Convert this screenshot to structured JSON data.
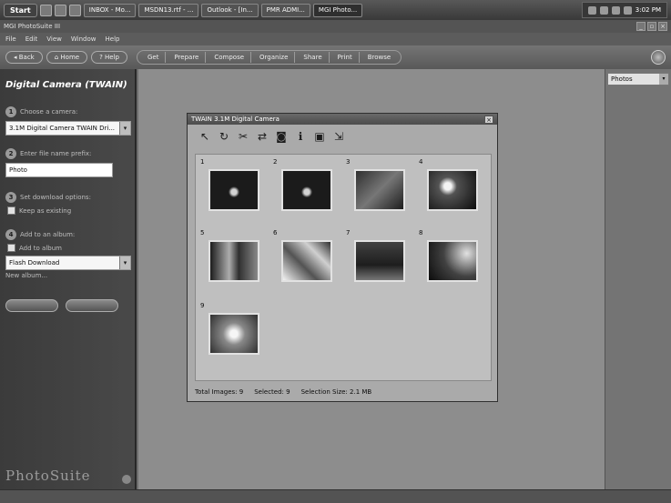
{
  "taskbar": {
    "start_label": "Start",
    "tasks": [
      "INBOX - Mo...",
      "MSDN13.rtf - ...",
      "Outlook - [In...",
      "PMR ADMI...",
      "MGI Photo..."
    ],
    "clock": "3:02 PM"
  },
  "window": {
    "title": "MGI PhotoSuite III",
    "minimize": "_",
    "maximize": "▫",
    "close": "×"
  },
  "menu": [
    "File",
    "Edit",
    "View",
    "Window",
    "Help"
  ],
  "modebar": {
    "back": "◂ Back",
    "home": "⌂ Home",
    "help": "? Help",
    "tabs": [
      "Get",
      "Prepare",
      "Compose",
      "Organize",
      "Share",
      "Print",
      "Browse"
    ]
  },
  "sidebar": {
    "title": "Digital Camera (TWAIN)",
    "step1_label": "Choose a camera:",
    "camera_value": "3.1M Digital Camera TWAIN Dri...",
    "step2_label": "Enter file name prefix:",
    "prefix_value": "Photo",
    "step3_label": "Set download options:",
    "step3_option": "Keep as existing",
    "step4_label": "Add to an album:",
    "step4_option": "Add to album",
    "album_value": "Flash Download",
    "small_label": "New album...",
    "logo": "PhotoSuite"
  },
  "rightpane": {
    "select_value": "Photos"
  },
  "dialog": {
    "title": "TWAIN 3.1M Digital Camera",
    "close": "×",
    "tools": [
      {
        "icon": "pointer-icon",
        "glyph": "↖"
      },
      {
        "icon": "rotate-icon",
        "glyph": "↻"
      },
      {
        "icon": "cut-icon",
        "glyph": "✂"
      },
      {
        "icon": "transfer-icon",
        "glyph": "⇄"
      },
      {
        "icon": "camera-icon",
        "glyph": "◙"
      },
      {
        "icon": "info-icon",
        "glyph": "ℹ"
      },
      {
        "icon": "select-icon",
        "glyph": "▣"
      },
      {
        "icon": "download-icon",
        "glyph": "⇲"
      }
    ],
    "thumbnails": [
      "1",
      "2",
      "3",
      "4",
      "5",
      "6",
      "7",
      "8",
      "9"
    ],
    "status": {
      "total": "Total Images: 9",
      "selected": "Selected: 9",
      "size": "Selection Size: 2.1 MB"
    }
  }
}
